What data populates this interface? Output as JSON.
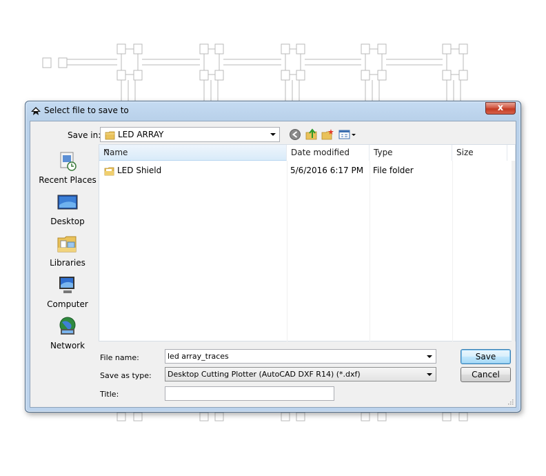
{
  "dialog": {
    "title": "Select file to save to",
    "close_label": "x"
  },
  "toolbar": {
    "save_in_label": "Save in:",
    "save_in_value": "LED ARRAY",
    "icons": [
      "back-icon",
      "up-folder-icon",
      "new-folder-icon",
      "view-menu-icon"
    ]
  },
  "places": [
    {
      "label": "Recent Places",
      "icon": "recent-places-icon"
    },
    {
      "label": "Desktop",
      "icon": "desktop-icon"
    },
    {
      "label": "Libraries",
      "icon": "libraries-icon"
    },
    {
      "label": "Computer",
      "icon": "computer-icon"
    },
    {
      "label": "Network",
      "icon": "network-icon"
    }
  ],
  "file_list": {
    "columns": [
      "Name",
      "Date modified",
      "Type",
      "Size"
    ],
    "rows": [
      {
        "name": "LED Shield",
        "date": "5/6/2016 6:17 PM",
        "type": "File folder",
        "size": ""
      }
    ]
  },
  "form": {
    "file_name_label": "File name:",
    "file_name_value": "led array_traces",
    "save_type_label": "Save as type:",
    "save_type_value": "Desktop Cutting Plotter (AutoCAD DXF R14) (*.dxf)",
    "title_label": "Title:",
    "title_value": ""
  },
  "buttons": {
    "save": "Save",
    "cancel": "Cancel"
  },
  "colors": {
    "accent": "#3c7fb1",
    "selection_header": "#d9ebf9",
    "close": "#c23a22"
  }
}
